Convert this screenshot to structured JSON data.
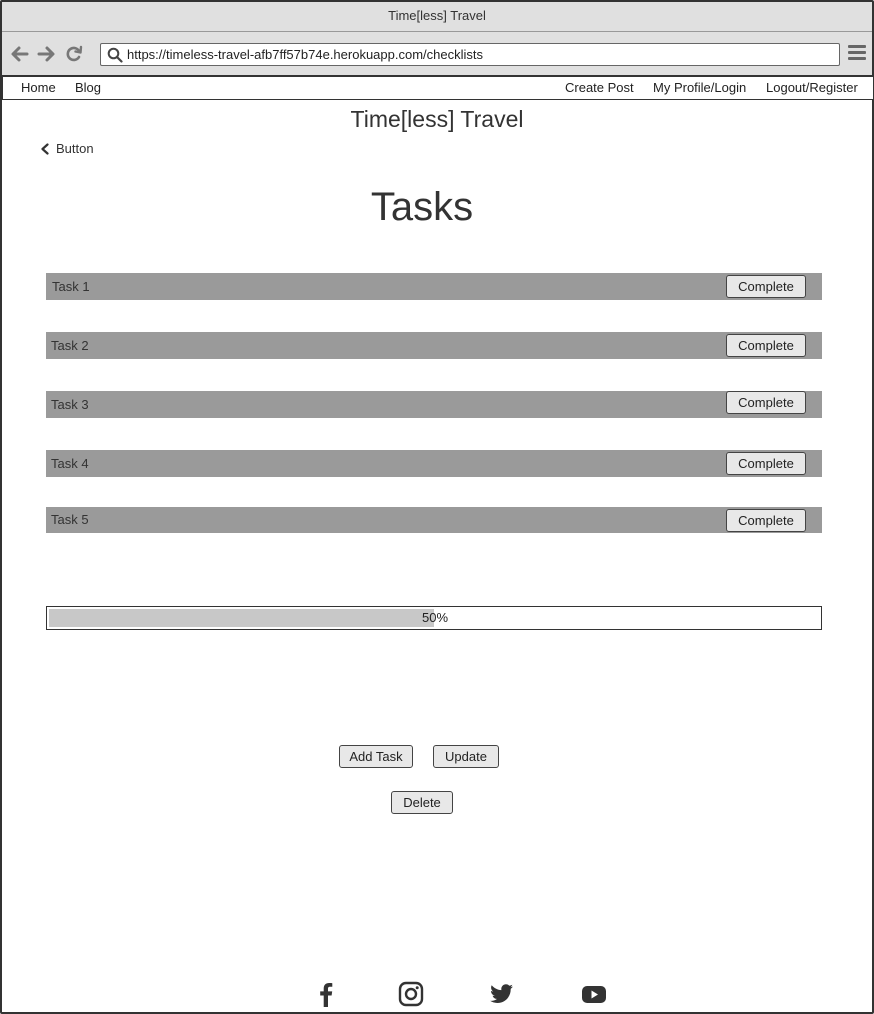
{
  "window": {
    "title": "Time[less] Travel"
  },
  "browser": {
    "url": "https://timeless-travel-afb7ff57b74e.herokuapp.com/checklists",
    "icons": [
      "back-arrow-icon",
      "forward-arrow-icon",
      "reload-icon",
      "search-icon",
      "menu-icon"
    ]
  },
  "nav": {
    "home": "Home",
    "blog": "Blog",
    "create_post": "Create Post",
    "profile": "My Profile/Login",
    "logout": "Logout/Register"
  },
  "site_title": "Time[less] Travel",
  "back_button": "Button",
  "page_heading": "Tasks",
  "tasks": [
    {
      "label": "Task 1",
      "action": "Complete"
    },
    {
      "label": "Task 2",
      "action": "Complete"
    },
    {
      "label": "Task 3",
      "action": "Complete"
    },
    {
      "label": "Task 4",
      "action": "Complete"
    },
    {
      "label": "Task 5",
      "action": "Complete"
    }
  ],
  "progress": {
    "value": 50,
    "label": "50%"
  },
  "actions": {
    "add_task": "Add Task",
    "update": "Update",
    "delete": "Delete"
  },
  "footer": {
    "social_icons": [
      "facebook-icon",
      "instagram-icon",
      "twitter-icon",
      "youtube-icon"
    ]
  },
  "colors": {
    "task_row_bg": "#9a9a9a",
    "progress_fill": "#c8c8c8",
    "chrome_bg": "#e0e0e0"
  }
}
